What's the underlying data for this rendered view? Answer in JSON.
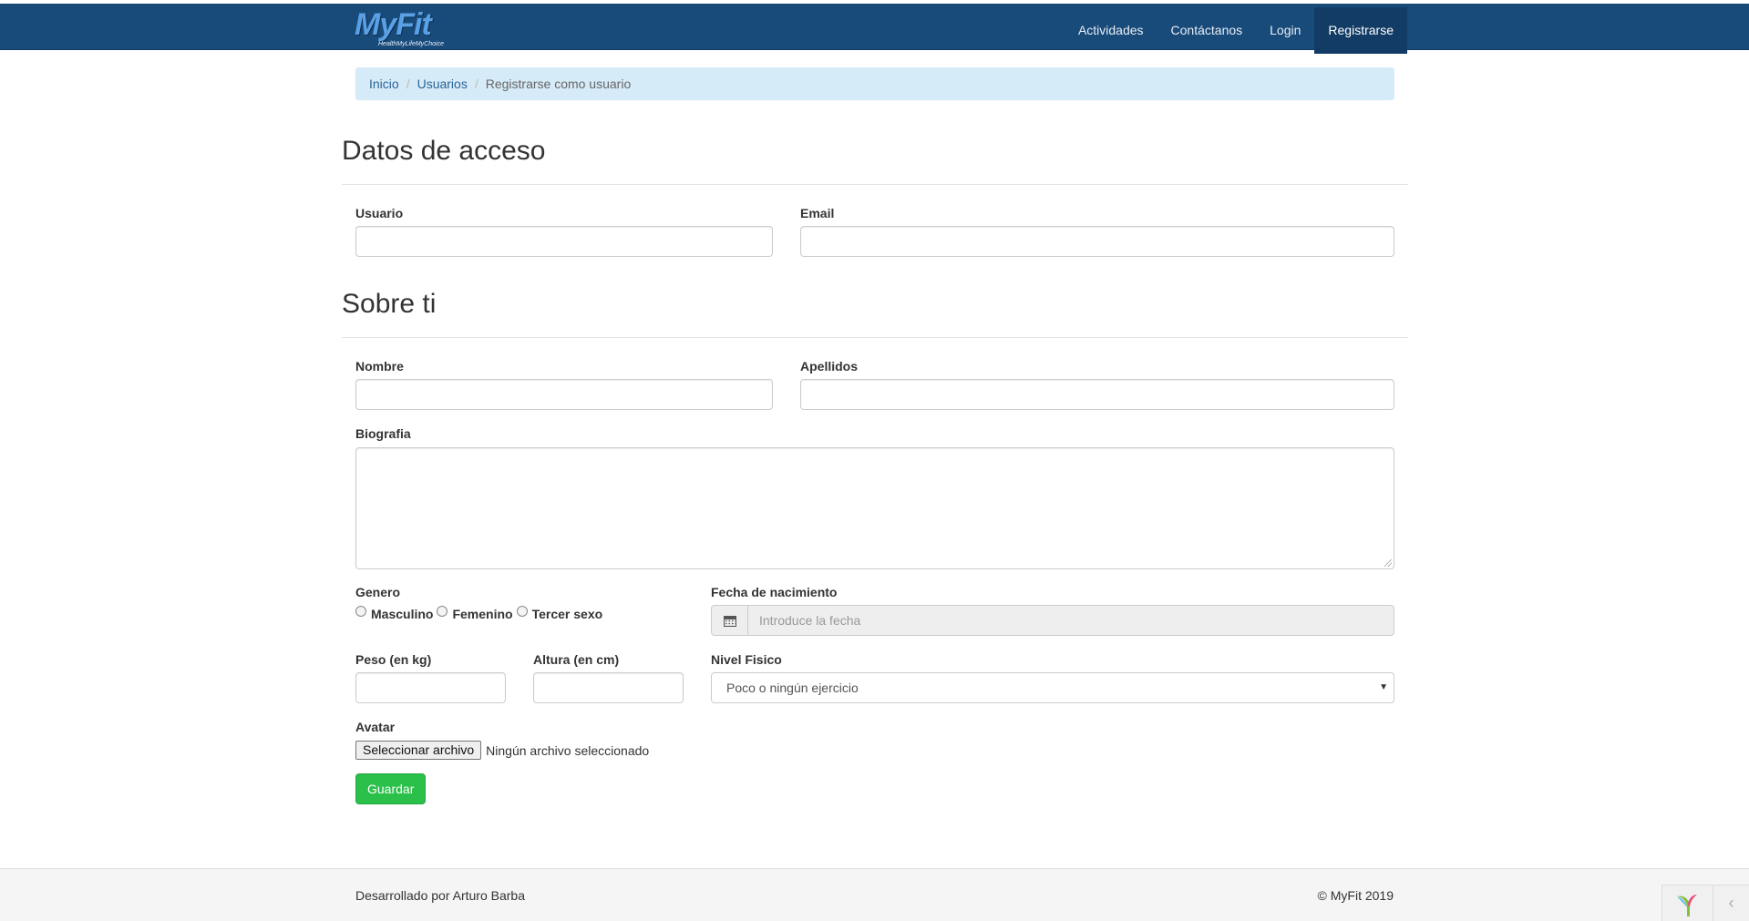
{
  "brand": {
    "logo_text": "MyFit",
    "tagline": "HealthMyLifeMyChoice"
  },
  "nav": {
    "items": [
      {
        "label": "Actividades"
      },
      {
        "label": "Contáctanos"
      },
      {
        "label": "Login"
      },
      {
        "label": "Registrarse",
        "active": true
      }
    ]
  },
  "breadcrumb": {
    "items": [
      {
        "label": "Inicio"
      },
      {
        "label": "Usuarios"
      }
    ],
    "current": "Registrarse como usuario"
  },
  "sections": {
    "access_title": "Datos de acceso",
    "about_title": "Sobre ti"
  },
  "form": {
    "usuario": {
      "label": "Usuario",
      "value": ""
    },
    "email": {
      "label": "Email",
      "value": ""
    },
    "nombre": {
      "label": "Nombre",
      "value": ""
    },
    "apellidos": {
      "label": "Apellidos",
      "value": ""
    },
    "biografia": {
      "label": "Biografia",
      "value": ""
    },
    "genero": {
      "label": "Genero",
      "options": [
        "Masculino",
        "Femenino",
        "Tercer sexo"
      ],
      "selected": null
    },
    "fecha": {
      "label": "Fecha de nacimiento",
      "placeholder": "Introduce la fecha"
    },
    "peso": {
      "label": "Peso (en kg)",
      "value": ""
    },
    "altura": {
      "label": "Altura (en cm)",
      "value": ""
    },
    "nivel": {
      "label": "Nivel Fisico",
      "selected": "Poco o ningún ejercicio"
    },
    "avatar": {
      "label": "Avatar",
      "button": "Seleccionar archivo",
      "status": "Ningún archivo seleccionado"
    },
    "submit": "Guardar"
  },
  "footer": {
    "left": "Desarrollado por Arturo Barba",
    "right": "© MyFit 2019"
  },
  "colors": {
    "navbar": "#184a7a",
    "breadcrumb_bg": "#d6ebf8",
    "save_button": "#2ac04a",
    "footer_bg": "#f5f5f5"
  },
  "icons": {
    "date_addon": "calendar-icon",
    "debug_toolbar": "yii-logo-icon",
    "debug_toggle": "chevron-left-icon"
  }
}
